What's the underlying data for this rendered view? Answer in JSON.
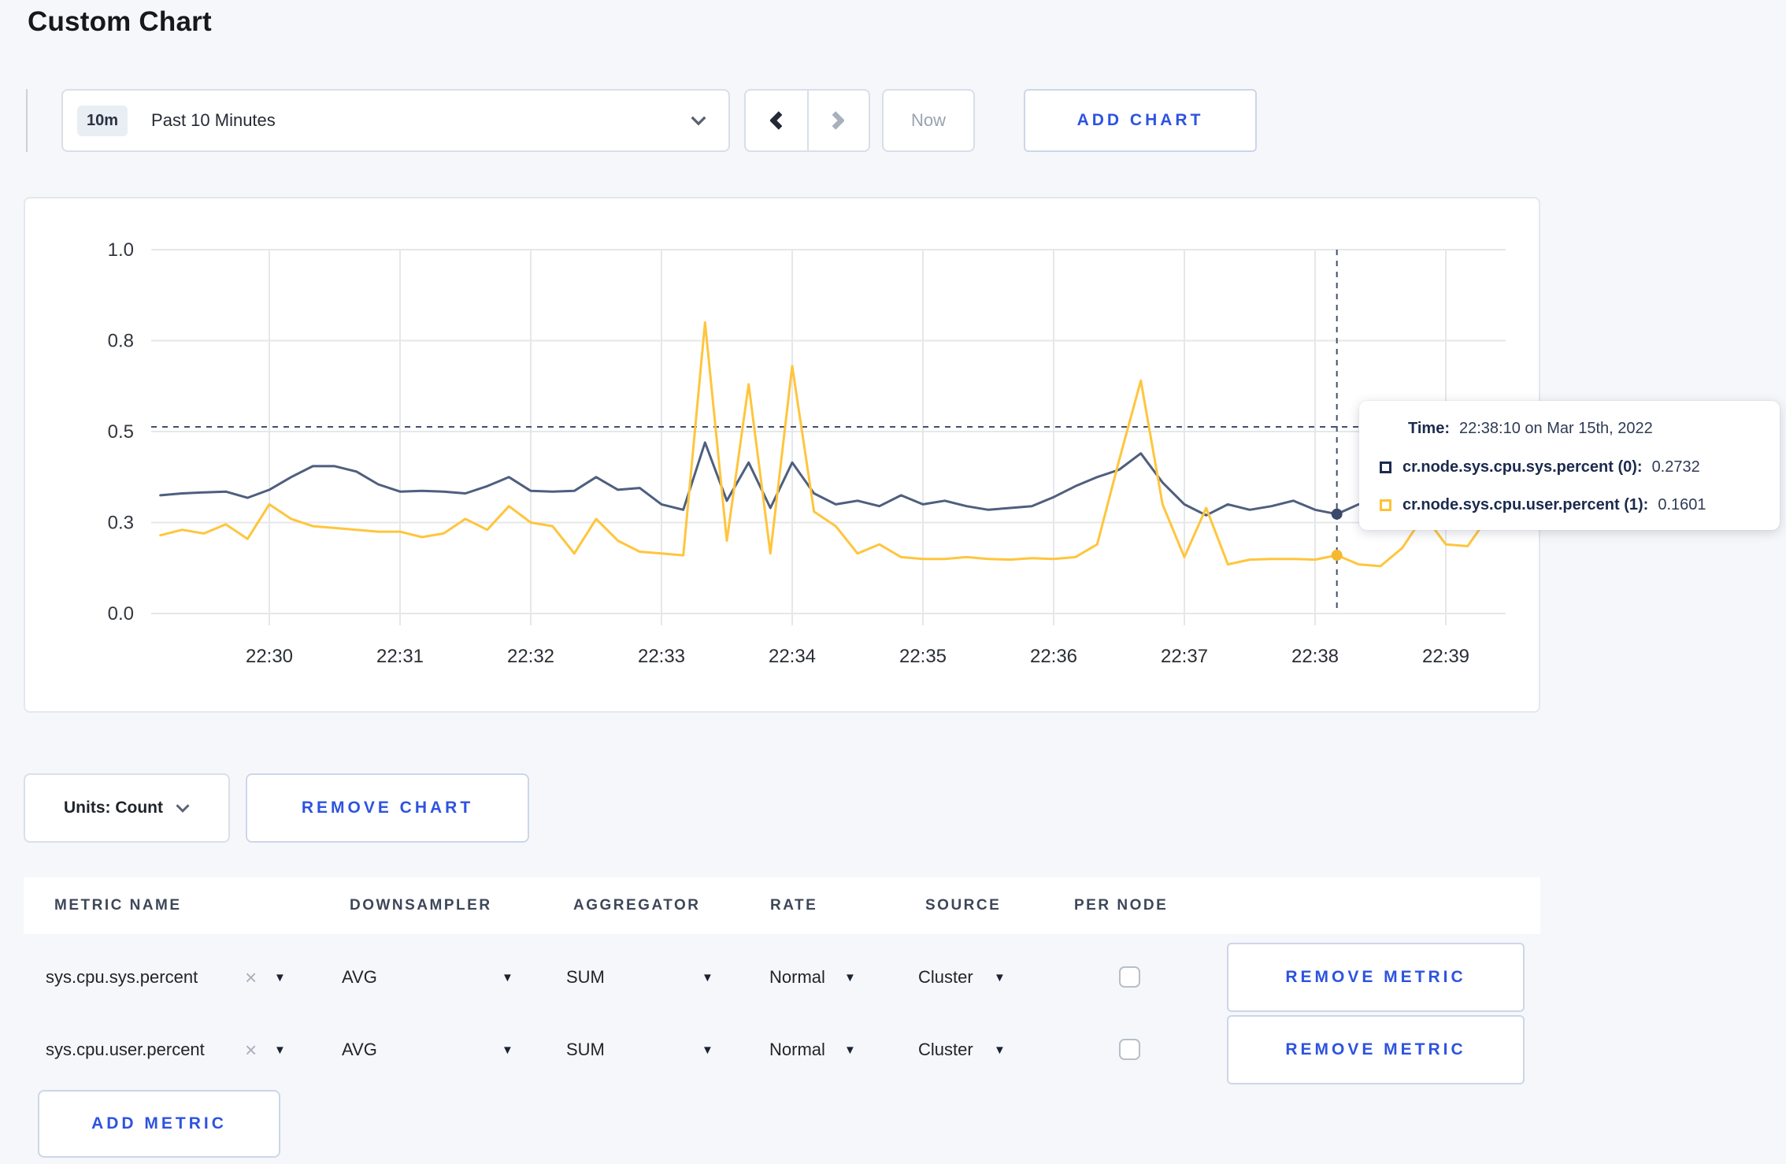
{
  "page": {
    "title": "Custom Chart",
    "background": "#f6f7fa",
    "accent_blue": "#2d53e0"
  },
  "toolbar": {
    "time_window_badge": "10m",
    "time_window_label": "Past 10 Minutes",
    "now_label": "Now",
    "add_chart_label": "ADD CHART"
  },
  "icons": {
    "time_dropdown_caret": "chevron-down",
    "prev": "chevron-left",
    "next": "chevron-right",
    "units_caret": "chevron-down",
    "remove_glyph": "×",
    "select_caret_glyph": "▼"
  },
  "chart": {
    "tooltip": {
      "time_label": "Time:",
      "time_value": "22:38:10 on Mar 15th, 2022",
      "series": [
        {
          "label": "cr.node.sys.cpu.sys.percent (0):",
          "value": "0.2732",
          "swatch_color": "#1b2a4e"
        },
        {
          "label": "cr.node.sys.cpu.user.percent (1):",
          "value": "0.1601",
          "swatch_color": "#ffc234"
        }
      ]
    }
  },
  "chart_data": {
    "type": "line",
    "title": "",
    "xlabel": "",
    "ylabel": "",
    "grid": true,
    "legend_position": "tooltip-only",
    "ylim": [
      0,
      1.0
    ],
    "y_tick_values": [
      0,
      0.25,
      0.5,
      0.75,
      1.0
    ],
    "y_tick_labels": [
      "0.0",
      "0.3",
      "0.5",
      "0.8",
      "1.0"
    ],
    "x_ticks": [
      "22:30",
      "22:31",
      "22:32",
      "22:33",
      "22:34",
      "22:35",
      "22:36",
      "22:37",
      "22:38",
      "22:39"
    ],
    "x_start_seconds": -50,
    "x_step_seconds": 10,
    "grid_color": "#e6e7ea",
    "series": [
      {
        "name": "cr.node.sys.cpu.sys.percent",
        "color": "#4e5f7e",
        "marker_color": "#3a4a6b",
        "values": [
          0.325,
          0.33,
          0.333,
          0.335,
          0.318,
          0.34,
          0.375,
          0.405,
          0.405,
          0.39,
          0.355,
          0.335,
          0.337,
          0.335,
          0.33,
          0.35,
          0.375,
          0.337,
          0.335,
          0.337,
          0.375,
          0.34,
          0.345,
          0.3,
          0.285,
          0.47,
          0.31,
          0.415,
          0.29,
          0.415,
          0.33,
          0.3,
          0.31,
          0.295,
          0.325,
          0.3,
          0.31,
          0.295,
          0.285,
          0.29,
          0.295,
          0.32,
          0.35,
          0.375,
          0.395,
          0.44,
          0.36,
          0.3,
          0.27,
          0.3,
          0.285,
          0.295,
          0.31,
          0.285,
          0.2732,
          0.3,
          0.31,
          0.295,
          0.3,
          0.31,
          0.3,
          0.295
        ]
      },
      {
        "name": "cr.node.sys.cpu.user.percent",
        "color": "#ffc53d",
        "marker_color": "#f5b82e",
        "values": [
          0.215,
          0.23,
          0.22,
          0.245,
          0.205,
          0.3,
          0.26,
          0.24,
          0.235,
          0.23,
          0.225,
          0.225,
          0.21,
          0.22,
          0.26,
          0.23,
          0.295,
          0.25,
          0.24,
          0.165,
          0.26,
          0.2,
          0.17,
          0.165,
          0.16,
          0.8,
          0.2,
          0.63,
          0.165,
          0.68,
          0.28,
          0.24,
          0.165,
          0.19,
          0.155,
          0.15,
          0.15,
          0.155,
          0.15,
          0.148,
          0.152,
          0.15,
          0.155,
          0.19,
          0.42,
          0.64,
          0.3,
          0.155,
          0.29,
          0.135,
          0.148,
          0.15,
          0.15,
          0.148,
          0.1601,
          0.135,
          0.13,
          0.18,
          0.27,
          0.19,
          0.185,
          0.27
        ]
      }
    ],
    "crosshair": {
      "time": "22:38:10",
      "x_seconds": 490,
      "hline_value": 0.513,
      "points": [
        {
          "series": "cr.node.sys.cpu.sys.percent",
          "value": 0.2732
        },
        {
          "series": "cr.node.sys.cpu.user.percent",
          "value": 0.1601
        }
      ],
      "color": "#3f4f6e"
    }
  },
  "chart_controls": {
    "units_label": "Units: Count",
    "remove_chart_label": "REMOVE CHART"
  },
  "metrics_table": {
    "headers": [
      "METRIC NAME",
      "DOWNSAMPLER",
      "AGGREGATOR",
      "RATE",
      "SOURCE",
      "PER NODE"
    ],
    "rows": [
      {
        "metric": "sys.cpu.sys.percent",
        "downsampler": "AVG",
        "aggregator": "SUM",
        "rate": "Normal",
        "source": "Cluster",
        "per_node_checked": false
      },
      {
        "metric": "sys.cpu.user.percent",
        "downsampler": "AVG",
        "aggregator": "SUM",
        "rate": "Normal",
        "source": "Cluster",
        "per_node_checked": false
      }
    ],
    "remove_metric_label": "REMOVE METRIC",
    "add_metric_label": "ADD METRIC"
  }
}
